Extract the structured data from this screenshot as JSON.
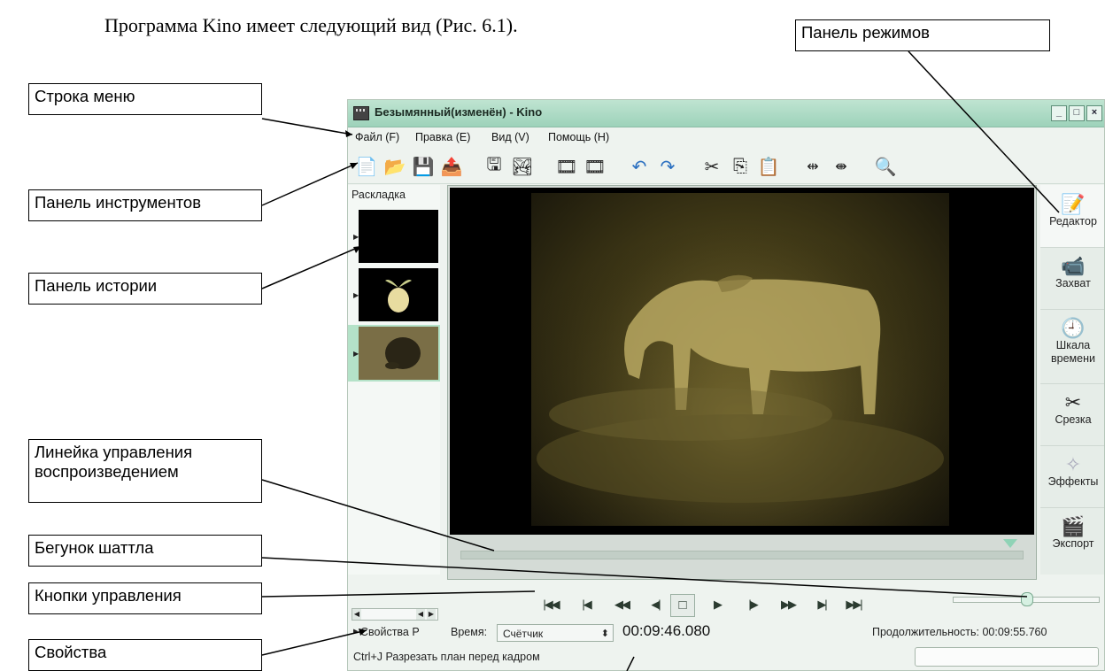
{
  "document": {
    "caption": "Программа Kino имеет следующий вид (Рис. 6.1)."
  },
  "annotations": {
    "menu_bar": "Строка меню",
    "toolbar": "Панель инструментов",
    "story_panel": "Панель истории",
    "playback_ruler": "Линейка управления воспроизведением",
    "shuttle": "Бегунок шаттла",
    "controls": "Кнопки управления",
    "properties": "Свойства",
    "modes_panel": "Панель режимов"
  },
  "window": {
    "title": "Безымянный(изменён) - Kino",
    "controls": [
      "_",
      "□",
      "×"
    ]
  },
  "menu": [
    "Файл (F)",
    "Правка (E)",
    "Вид (V)",
    "Помощь (H)"
  ],
  "toolbar_icons": [
    "new-file-icon",
    "open-folder-icon",
    "save-icon",
    "export-icon",
    "save-frame-icon",
    "publish-icon",
    "insert-before-icon",
    "insert-after-icon",
    "undo-icon",
    "redo-icon",
    "cut-icon",
    "copy-icon",
    "paste-icon",
    "split-icon",
    "join-icon",
    "zoom-icon"
  ],
  "story": {
    "label": "Раскладка",
    "clips": [
      {
        "name": "black-clip",
        "selected": false
      },
      {
        "name": "fruit-clip",
        "selected": false
      },
      {
        "name": "hedgehog-clip",
        "selected": true
      }
    ]
  },
  "modes": [
    {
      "label": "Редактор",
      "icon": "editor-icon",
      "active": true
    },
    {
      "label": "Захват",
      "icon": "capture-icon",
      "active": false
    },
    {
      "label": "Шкала времени",
      "icon": "timeline-icon",
      "active": false
    },
    {
      "label": "Срезка",
      "icon": "trim-icon",
      "active": false
    },
    {
      "label": "Эффекты",
      "icon": "effects-icon",
      "active": false
    },
    {
      "label": "Экспорт",
      "icon": "export-mode-icon",
      "active": false
    }
  ],
  "transport_buttons": [
    "start",
    "prev-scene",
    "rewind",
    "prev-frame",
    "stop",
    "play",
    "next-frame",
    "fast-forward",
    "next-scene",
    "end"
  ],
  "status": {
    "properties_label": "Свойства P",
    "time_label": "Время:",
    "time_mode": "Счётчик",
    "timecode": "00:09:46.080",
    "duration_label": "Продолжительность: 00:09:55.760",
    "hint": "Ctrl+J  Разрезать план перед кадром"
  }
}
